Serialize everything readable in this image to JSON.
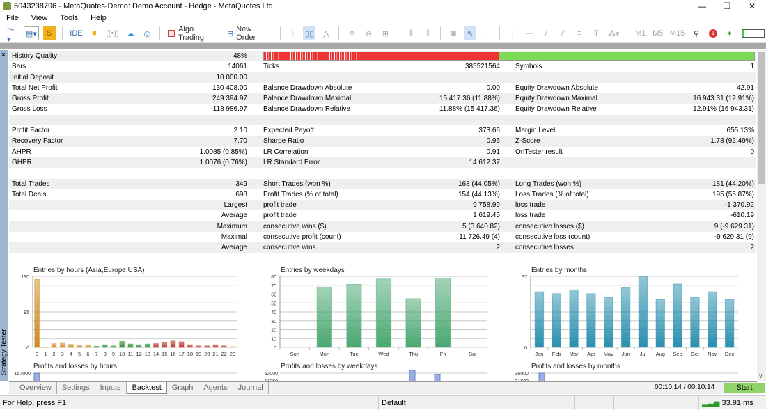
{
  "window": {
    "title": "5043238796 - MetaQuotes-Demo: Demo Account - Hedge - MetaQuotes Ltd.",
    "minimize": "—",
    "maximize": "❐",
    "close": "✕"
  },
  "menu": [
    "File",
    "View",
    "Tools",
    "Help"
  ],
  "toolbar": {
    "ide": "IDE",
    "algo_trading": "Algo Trading",
    "new_order": "New Order",
    "timeframes": [
      "M1",
      "M5",
      "M15"
    ],
    "notification_count": "1"
  },
  "panel": {
    "side_label": "Strategy Tester",
    "close": "×"
  },
  "report": {
    "history_quality": {
      "label": "History Quality",
      "value": "48%",
      "percent": 48
    },
    "rows": [
      [
        "",
        "",
        "",
        "",
        "",
        ""
      ],
      [
        "Bars",
        "14061",
        "Ticks",
        "385521564",
        "Symbols",
        "1"
      ],
      [
        "Initial Deposit",
        "10 000.00",
        "",
        "",
        "",
        ""
      ],
      [
        "Total Net Profit",
        "130 408.00",
        "Balance Drawdown Absolute",
        "0.00",
        "Equity Drawdown Absolute",
        "42.91"
      ],
      [
        "Gross Profit",
        "249 394.97",
        "Balance Drawdown Maximal",
        "15 417.36 (11.88%)",
        "Equity Drawdown Maximal",
        "16 943.31 (12.91%)"
      ],
      [
        "Gross Loss",
        "-118 986.97",
        "Balance Drawdown Relative",
        "11.88% (15 417.36)",
        "Equity Drawdown Relative",
        "12.91% (16 943.31)"
      ],
      [
        "",
        "",
        "",
        "",
        "",
        ""
      ],
      [
        "Profit Factor",
        "2.10",
        "Expected Payoff",
        "373.66",
        "Margin Level",
        "655.13%"
      ],
      [
        "Recovery Factor",
        "7.70",
        "Sharpe Ratio",
        "0.96",
        "Z-Score",
        "1.78 (92.49%)"
      ],
      [
        "AHPR",
        "1.0085 (0.85%)",
        "LR Correlation",
        "0.91",
        "OnTester result",
        "0"
      ],
      [
        "GHPR",
        "1.0076 (0.76%)",
        "LR Standard Error",
        "14 612.37",
        "",
        ""
      ],
      [
        "",
        "",
        "",
        "",
        "",
        ""
      ],
      [
        "Total Trades",
        "349",
        "Short Trades (won %)",
        "168 (44.05%)",
        "Long Trades (won %)",
        "181 (44.20%)"
      ],
      [
        "Total Deals",
        "698",
        "Profit Trades (% of total)",
        "154 (44.13%)",
        "Loss Trades (% of total)",
        "195 (55.87%)"
      ],
      [
        "",
        "Largest",
        "profit trade",
        "9 758.99",
        "loss trade",
        "-1 370.92"
      ],
      [
        "",
        "Average",
        "profit trade",
        "1 619.45",
        "loss trade",
        "-610.19"
      ],
      [
        "",
        "Maximum",
        "consecutive wins ($)",
        "5 (3 640.82)",
        "consecutive losses ($)",
        "9 (-9 629.31)"
      ],
      [
        "",
        "Maximal",
        "consecutive profit (count)",
        "11 726.49 (4)",
        "consecutive loss (count)",
        "-9 629.31 (9)"
      ],
      [
        "",
        "Average",
        "consecutive wins",
        "2",
        "consecutive losses",
        "2"
      ]
    ]
  },
  "chart_data": [
    {
      "type": "bar",
      "title": "Entries by hours (Asia,Europe,USA)",
      "categories": [
        "0",
        "1",
        "2",
        "3",
        "4",
        "5",
        "6",
        "7",
        "8",
        "9",
        "10",
        "11",
        "12",
        "13",
        "14",
        "15",
        "16",
        "17",
        "18",
        "19",
        "20",
        "21",
        "22",
        "23"
      ],
      "values": [
        182,
        1,
        10,
        11,
        8,
        5,
        5,
        3,
        7,
        4,
        16,
        9,
        7,
        9,
        10,
        13,
        17,
        15,
        7,
        4,
        4,
        7,
        4,
        2
      ],
      "ylim": [
        0,
        190
      ],
      "yticks": [
        "0",
        "95",
        "190"
      ],
      "colors": [
        "#d08a1e",
        "#d08a1e",
        "#d08a1e",
        "#d08a1e",
        "#d08a1e",
        "#d08a1e",
        "#d08a1e",
        "#2a8a2a",
        "#2a8a2a",
        "#2a8a2a",
        "#2a8a2a",
        "#2a8a2a",
        "#2a8a2a",
        "#2a8a2a",
        "#b83322",
        "#b83322",
        "#b83322",
        "#b83322",
        "#b83322",
        "#b83322",
        "#b83322",
        "#b83322",
        "#b83322",
        "#e8b040"
      ],
      "grid": true
    },
    {
      "type": "bar",
      "title": "Entries by weekdays",
      "categories": [
        "Sun",
        "Mon",
        "Tue",
        "Wed",
        "Thu",
        "Fri",
        "Sat"
      ],
      "values": [
        0,
        68,
        71,
        77,
        55,
        78,
        0
      ],
      "ylim": [
        0,
        80
      ],
      "yticks": [
        "0",
        "10",
        "20",
        "30",
        "40",
        "50",
        "60",
        "70",
        "80"
      ],
      "color": "#4aa872",
      "grid": true
    },
    {
      "type": "bar",
      "title": "Entries by months",
      "categories": [
        "Jan",
        "Feb",
        "Mar",
        "Apr",
        "May",
        "Jun",
        "Jul",
        "Aug",
        "Sep",
        "Oct",
        "Nov",
        "Dec"
      ],
      "values": [
        29,
        28,
        30,
        28,
        26,
        31,
        37,
        25,
        33,
        26,
        29,
        25
      ],
      "ylim": [
        0,
        37
      ],
      "yticks": [
        "0",
        "37"
      ],
      "color": "#2a8fae",
      "grid": true
    }
  ],
  "lower_charts": [
    {
      "title": "Profits and losses by hours",
      "ytick": "157000"
    },
    {
      "title": "Profits and losses by weekdays",
      "ytick": "62000",
      "ytick2": "54250"
    },
    {
      "title": "Profits and losses by months",
      "ytick": "36000",
      "ytick2": "31500"
    }
  ],
  "tabs": [
    "Overview",
    "Settings",
    "Inputs",
    "Backtest",
    "Graph",
    "Agents",
    "Journal"
  ],
  "active_tab": "Backtest",
  "timer": "00:10:14 / 00:10:14",
  "start_label": "Start",
  "status": {
    "help": "For Help, press F1",
    "profile": "Default",
    "ping": "33.91 ms"
  }
}
